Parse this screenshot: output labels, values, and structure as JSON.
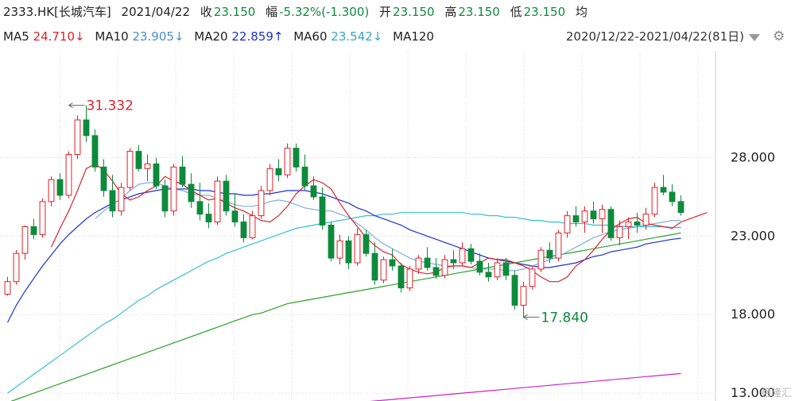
{
  "header": {
    "code": "2333.HK[长城汽车]",
    "date": "2021/04/22",
    "close_label": "收",
    "close": "23.150",
    "change_label": "幅",
    "change_pct": "-5.32%",
    "change_abs": "(-1.300)",
    "open_label": "开",
    "open": "23.150",
    "high_label": "高",
    "high": "23.150",
    "low_label": "低",
    "low": "23.150",
    "avg_label": "均"
  },
  "ma_bar": {
    "ma5_label": "MA5",
    "ma5": "24.710↓",
    "ma10_label": "MA10",
    "ma10": "23.905↓",
    "ma20_label": "MA20",
    "ma20": "22.859↑",
    "ma60_label": "MA60",
    "ma60": "23.542↓",
    "ma120_label": "MA120",
    "period": "2020/12/22-2021/04/22(81日)"
  },
  "watermark": "格隆汇",
  "chart_data": {
    "type": "candlestick",
    "ylim": [
      12.5,
      34.8
    ],
    "y_ticks": [
      "28.000",
      "23.000",
      "18.000",
      "13.000"
    ],
    "y_tick_values": [
      28,
      23,
      18,
      13
    ],
    "annotations": [
      {
        "text": "31.332",
        "value": 31.332,
        "index": 7
      },
      {
        "text": "17.840",
        "value": 17.84,
        "index": 59
      }
    ],
    "colors": {
      "up": "#e0202a",
      "down": "#0e8a3c",
      "ma5": "#e0202a",
      "ma10": "#7fb0d8",
      "ma20": "#1b32d6",
      "ma60": "#35c0d0",
      "ma120": "#2aa52a",
      "ma250": "#cc22cc",
      "grid": "#d9d9d9"
    },
    "candles": [
      [
        19.3,
        20.4,
        19.2,
        20.1
      ],
      [
        20.1,
        22.1,
        19.9,
        21.9
      ],
      [
        21.9,
        23.7,
        21.5,
        23.6
      ],
      [
        23.6,
        24.1,
        22.8,
        23.1
      ],
      [
        23.1,
        25.4,
        22.9,
        25.2
      ],
      [
        25.2,
        26.8,
        24.9,
        26.6
      ],
      [
        26.6,
        27.0,
        25.3,
        25.6
      ],
      [
        25.6,
        28.4,
        25.4,
        28.2
      ],
      [
        28.2,
        30.7,
        27.9,
        30.4
      ],
      [
        30.4,
        31.332,
        29.0,
        29.4
      ],
      [
        29.4,
        29.8,
        27.1,
        27.4
      ],
      [
        27.4,
        27.9,
        25.5,
        25.9
      ],
      [
        25.9,
        26.9,
        24.2,
        24.6
      ],
      [
        24.6,
        26.4,
        24.3,
        26.1
      ],
      [
        26.1,
        28.6,
        25.9,
        28.4
      ],
      [
        28.4,
        28.8,
        27.1,
        27.3
      ],
      [
        27.3,
        28.2,
        26.5,
        27.6
      ],
      [
        27.6,
        28.0,
        26.0,
        26.2
      ],
      [
        26.2,
        26.6,
        24.2,
        24.6
      ],
      [
        24.6,
        27.6,
        24.3,
        27.4
      ],
      [
        27.4,
        28.1,
        26.1,
        26.3
      ],
      [
        26.3,
        27.0,
        24.8,
        25.2
      ],
      [
        25.2,
        26.4,
        24.0,
        24.4
      ],
      [
        24.4,
        25.1,
        23.5,
        23.9
      ],
      [
        23.9,
        26.8,
        23.7,
        26.5
      ],
      [
        26.5,
        26.9,
        24.3,
        24.6
      ],
      [
        24.6,
        25.7,
        23.6,
        23.9
      ],
      [
        23.9,
        24.4,
        22.6,
        22.9
      ],
      [
        22.9,
        24.6,
        22.8,
        24.3
      ],
      [
        24.3,
        26.2,
        24.1,
        25.9
      ],
      [
        25.9,
        27.6,
        25.6,
        27.3
      ],
      [
        27.3,
        27.9,
        26.5,
        26.9
      ],
      [
        26.9,
        28.9,
        26.7,
        28.6
      ],
      [
        28.6,
        28.9,
        27.1,
        27.4
      ],
      [
        27.4,
        28.2,
        25.9,
        26.2
      ],
      [
        26.2,
        26.8,
        25.3,
        25.5
      ],
      [
        25.5,
        26.1,
        23.4,
        23.7
      ],
      [
        23.7,
        23.9,
        21.4,
        21.6
      ],
      [
        21.6,
        23.1,
        21.2,
        22.7
      ],
      [
        22.7,
        23.0,
        20.9,
        21.3
      ],
      [
        21.3,
        23.5,
        21.1,
        23.1
      ],
      [
        23.1,
        23.4,
        21.7,
        21.9
      ],
      [
        21.9,
        22.6,
        19.9,
        20.2
      ],
      [
        20.2,
        21.7,
        20.0,
        21.5
      ],
      [
        21.5,
        22.2,
        20.8,
        21.1
      ],
      [
        21.1,
        21.3,
        19.4,
        19.7
      ],
      [
        19.7,
        21.1,
        19.5,
        20.9
      ],
      [
        20.9,
        21.8,
        20.6,
        21.6
      ],
      [
        21.6,
        22.3,
        20.8,
        21.0
      ],
      [
        21.0,
        21.6,
        20.3,
        20.5
      ],
      [
        20.5,
        21.8,
        20.3,
        21.5
      ],
      [
        21.5,
        22.1,
        20.9,
        21.3
      ],
      [
        21.3,
        22.6,
        21.1,
        22.2
      ],
      [
        22.2,
        22.5,
        21.2,
        21.4
      ],
      [
        21.4,
        21.9,
        20.5,
        20.7
      ],
      [
        20.7,
        21.3,
        20.1,
        20.4
      ],
      [
        20.4,
        21.6,
        20.2,
        21.3
      ],
      [
        21.3,
        21.6,
        20.2,
        20.5
      ],
      [
        20.5,
        20.8,
        18.3,
        18.6
      ],
      [
        18.6,
        20.1,
        17.84,
        19.8
      ],
      [
        19.8,
        21.1,
        19.6,
        20.9
      ],
      [
        20.9,
        22.3,
        20.7,
        22.1
      ],
      [
        22.1,
        22.6,
        21.3,
        21.6
      ],
      [
        21.6,
        23.4,
        21.4,
        23.2
      ],
      [
        23.2,
        24.6,
        22.9,
        24.3
      ],
      [
        24.3,
        24.9,
        23.6,
        23.9
      ],
      [
        23.9,
        24.9,
        23.2,
        24.6
      ],
      [
        24.6,
        25.2,
        23.8,
        24.1
      ],
      [
        24.1,
        25.0,
        23.2,
        24.7
      ],
      [
        24.7,
        24.9,
        22.7,
        22.9
      ],
      [
        22.9,
        24.0,
        22.4,
        23.6
      ],
      [
        23.6,
        24.2,
        22.8,
        23.9
      ],
      [
        23.9,
        24.5,
        23.2,
        23.7
      ],
      [
        23.7,
        24.8,
        23.4,
        24.4
      ],
      [
        24.4,
        26.4,
        24.2,
        26.1
      ],
      [
        26.1,
        26.9,
        25.6,
        25.8
      ],
      [
        25.8,
        26.3,
        24.9,
        25.2
      ],
      [
        25.2,
        25.6,
        24.3,
        24.5
      ]
    ],
    "ma": {
      "ma5": {
        "start": 5,
        "values": [
          22.3,
          23.5,
          24.6,
          25.9,
          27.3,
          27.6,
          27.2,
          26.5,
          25.7,
          25.3,
          25.5,
          25.9,
          26.2,
          26.8,
          26.5,
          26.3,
          25.9,
          25.6,
          25.3,
          25.4,
          25.1,
          24.8,
          24.6,
          24.3,
          24.0,
          23.9,
          24.3,
          24.9,
          25.7,
          26.2,
          26.6,
          26.4,
          26.0,
          25.1,
          24.3,
          23.6,
          22.9,
          22.4,
          22.0,
          21.8,
          21.2,
          20.9,
          20.7,
          20.6,
          20.7,
          21.0,
          21.1,
          21.1,
          21.0,
          21.3,
          21.6,
          21.5,
          21.5,
          21.3,
          21.1,
          20.8,
          20.4,
          20.1,
          20.1,
          20.4,
          21.1,
          21.5,
          22.1,
          22.8,
          23.4,
          23.8,
          24.1,
          24.2,
          23.8,
          23.7,
          23.6,
          23.5,
          23.9,
          24.1,
          24.3,
          24.5
        ]
      },
      "ma10": {
        "start": 10,
        "values": [
          24.1,
          24.6,
          25.0,
          25.4,
          25.9,
          26.3,
          26.4,
          26.4,
          26.2,
          26.0,
          25.9,
          25.7,
          25.6,
          25.6,
          25.4,
          25.2,
          25.0,
          24.9,
          24.9,
          25.0,
          25.2,
          25.3,
          25.2,
          25.0,
          24.8,
          24.7,
          24.6,
          24.6,
          24.4,
          24.2,
          23.8,
          23.4,
          22.9,
          22.5,
          22.2,
          21.9,
          21.6,
          21.4,
          21.3,
          21.2,
          21.1,
          21.1,
          21.1,
          21.0,
          20.9,
          20.9,
          20.9,
          20.8,
          20.8,
          20.9,
          21.1,
          21.3,
          21.5,
          21.7,
          22.0,
          22.3,
          22.6,
          22.9,
          23.1,
          23.3,
          23.4,
          23.5,
          23.6,
          23.7,
          23.8,
          23.9,
          24.0,
          24.0
        ]
      },
      "ma20": {
        "start": 0,
        "values": [
          17.5,
          18.6,
          19.5,
          20.3,
          21.1,
          21.8,
          22.5,
          23.1,
          23.6,
          24.1,
          24.5,
          24.8,
          25.1,
          25.3,
          25.5,
          25.7,
          25.8,
          25.9,
          26.0,
          26.0,
          26.0,
          26.0,
          25.9,
          25.9,
          25.8,
          25.7,
          25.7,
          25.6,
          25.6,
          25.7,
          25.7,
          25.8,
          25.9,
          25.9,
          25.9,
          25.8,
          25.7,
          25.5,
          25.3,
          25.1,
          24.8,
          24.6,
          24.3,
          24.1,
          23.9,
          23.7,
          23.4,
          23.2,
          23.0,
          22.8,
          22.6,
          22.4,
          22.2,
          22.0,
          21.8,
          21.6,
          21.5,
          21.4,
          21.3,
          21.2,
          21.1,
          21.0,
          21.0,
          21.1,
          21.2,
          21.3,
          21.5,
          21.7,
          21.8,
          22.0,
          22.1,
          22.2,
          22.3,
          22.5,
          22.6,
          22.7,
          22.8,
          22.86
        ]
      },
      "ma60": {
        "start": 0,
        "values": [
          13.0,
          13.4,
          13.8,
          14.2,
          14.6,
          15.0,
          15.4,
          15.8,
          16.2,
          16.6,
          17.0,
          17.4,
          17.7,
          18.1,
          18.5,
          18.9,
          19.2,
          19.6,
          19.9,
          20.2,
          20.5,
          20.8,
          21.1,
          21.4,
          21.6,
          21.9,
          22.1,
          22.3,
          22.5,
          22.7,
          22.9,
          23.1,
          23.3,
          23.5,
          23.6,
          23.7,
          23.8,
          23.9,
          24.0,
          24.1,
          24.2,
          24.3,
          24.3,
          24.4,
          24.4,
          24.5,
          24.5,
          24.5,
          24.5,
          24.5,
          24.5,
          24.5,
          24.5,
          24.4,
          24.4,
          24.3,
          24.3,
          24.2,
          24.2,
          24.1,
          24.0,
          24.0,
          23.9,
          23.9,
          23.8,
          23.8,
          23.8,
          23.7,
          23.7,
          23.7,
          23.6,
          23.6,
          23.6,
          23.6,
          23.6,
          23.6,
          23.55,
          23.542
        ]
      },
      "ma120": {
        "start": 0,
        "values": [
          12.4,
          12.6,
          12.8,
          13.0,
          13.2,
          13.4,
          13.6,
          13.8,
          14.0,
          14.2,
          14.4,
          14.6,
          14.8,
          15.0,
          15.2,
          15.4,
          15.6,
          15.8,
          16.0,
          16.2,
          16.4,
          16.6,
          16.8,
          17.0,
          17.2,
          17.4,
          17.6,
          17.8,
          18.0,
          18.1,
          18.3,
          18.5,
          18.7,
          18.8,
          18.9,
          19.0,
          19.1,
          19.2,
          19.3,
          19.4,
          19.5,
          19.6,
          19.7,
          19.8,
          19.9,
          20.0,
          20.1,
          20.2,
          20.3,
          20.4,
          20.5,
          20.6,
          20.7,
          20.8,
          20.9,
          21.0,
          21.1,
          21.2,
          21.3,
          21.4,
          21.5,
          21.6,
          21.7,
          21.8,
          21.9,
          22.0,
          22.1,
          22.2,
          22.3,
          22.4,
          22.5,
          22.6,
          22.7,
          22.8,
          22.9,
          23.0,
          23.1,
          23.2
        ]
      },
      "ma250": {
        "start": 40,
        "values": [
          12.4,
          12.45,
          12.5,
          12.55,
          12.6,
          12.65,
          12.7,
          12.75,
          12.8,
          12.85,
          12.9,
          12.95,
          13.0,
          13.05,
          13.1,
          13.15,
          13.2,
          13.25,
          13.3,
          13.35,
          13.4,
          13.45,
          13.5,
          13.55,
          13.6,
          13.65,
          13.7,
          13.75,
          13.8,
          13.85,
          13.9,
          13.95,
          14.0,
          14.05,
          14.1,
          14.15,
          14.2,
          14.25
        ]
      }
    }
  }
}
